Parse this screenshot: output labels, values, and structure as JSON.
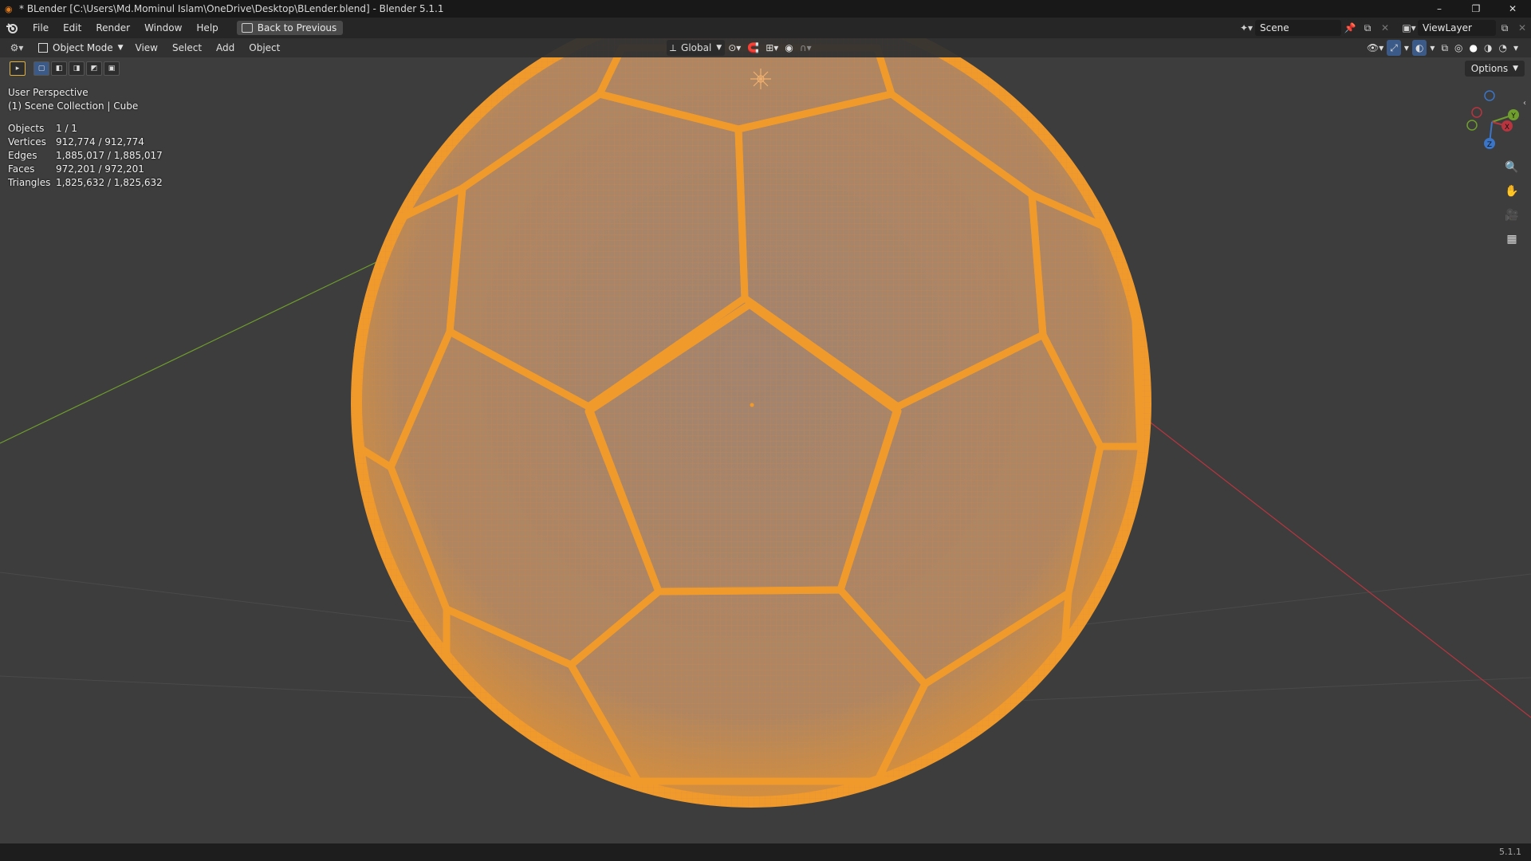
{
  "window": {
    "title": "* BLender [C:\\Users\\Md.Mominul Islam\\OneDrive\\Desktop\\BLender.blend] - Blender 5.1.1",
    "controls": [
      "–",
      "❐",
      "✕"
    ]
  },
  "menubar": {
    "items": [
      "File",
      "Edit",
      "Render",
      "Window",
      "Help"
    ],
    "back_button": "Back to Previous",
    "scene": "Scene",
    "view_layer": "ViewLayer"
  },
  "viewport_header": {
    "mode": "Object Mode",
    "menus": [
      "View",
      "Select",
      "Add",
      "Object"
    ],
    "transform_orientation": "Global"
  },
  "toolbar": {
    "options_label": "Options"
  },
  "overlay": {
    "perspective": "User Perspective",
    "collection": "(1) Scene Collection | Cube"
  },
  "stats": [
    {
      "label": "Objects",
      "value": "1 / 1"
    },
    {
      "label": "Vertices",
      "value": "912,774 / 912,774"
    },
    {
      "label": "Edges",
      "value": "1,885,017 / 1,885,017"
    },
    {
      "label": "Faces",
      "value": "972,201 / 972,201"
    },
    {
      "label": "Triangles",
      "value": "1,825,632 / 1,825,632"
    }
  ],
  "gizmo": {
    "x_label": "X",
    "y_label": "Y",
    "z_label": "Z"
  },
  "colors": {
    "selection": "#f19a2c",
    "ball_fill": "#a4846a",
    "x_axis": "#b8353f",
    "y_axis": "#6f9e2c"
  },
  "statusbar": {
    "version": "5.1.1"
  }
}
